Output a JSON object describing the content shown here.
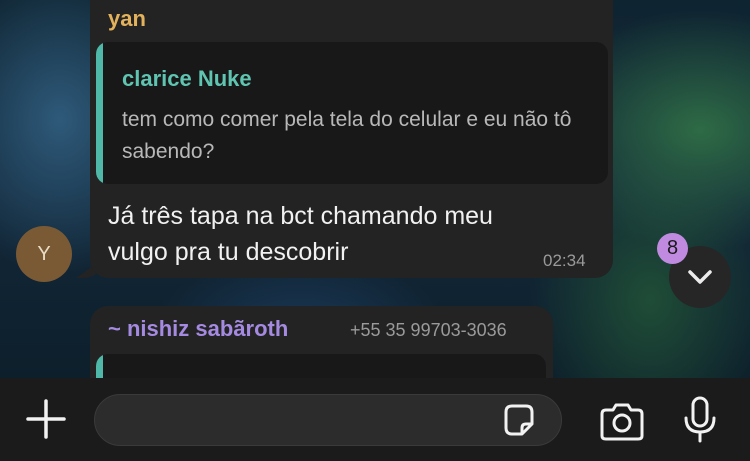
{
  "message1": {
    "sender": "yan",
    "quoted": {
      "author": "clarice Nuke",
      "text": "tem como comer pela tela do celular e eu não tô sabendo?"
    },
    "text": "Já três tapa na bct chamando meu vulgo pra tu descobrir",
    "time": "02:34",
    "avatar_initial": "Y"
  },
  "message2": {
    "sender": "~ nishiz sabãroth",
    "phone": "+55 35 99703-3036"
  },
  "scroll_down": {
    "unread_count": "8",
    "icon": "chevron-down-icon"
  },
  "composer": {
    "placeholder": "",
    "icons": [
      "plus-icon",
      "sticker-icon",
      "camera-icon",
      "microphone-icon"
    ]
  },
  "colors": {
    "sender1": "#e3b25c",
    "quote_author": "#5fc4b0",
    "sender2": "#a48ae0",
    "badge": "#c08ae0"
  }
}
